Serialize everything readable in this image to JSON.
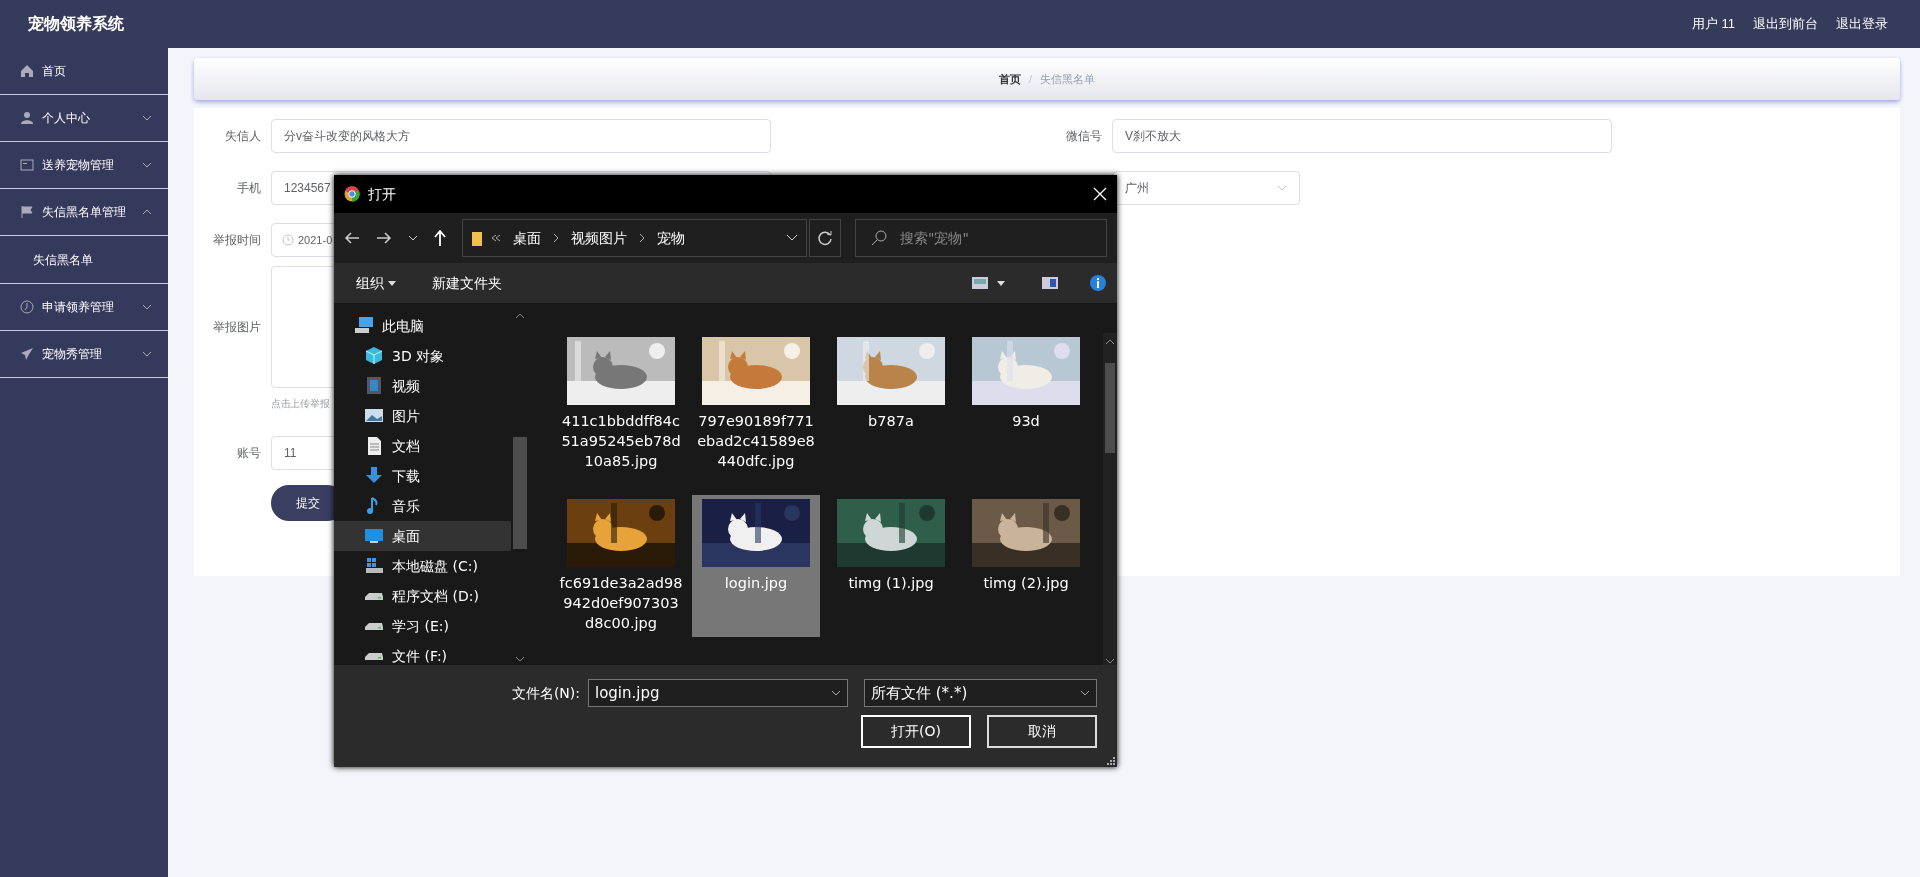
{
  "app": {
    "title": "宠物领养系统"
  },
  "top_nav": [
    {
      "label": "用户 11"
    },
    {
      "label": "退出到前台"
    },
    {
      "label": "退出登录"
    }
  ],
  "sidebar": {
    "items": [
      {
        "label": "首页",
        "kind": "link"
      },
      {
        "label": "个人中心",
        "kind": "group",
        "expanded": false
      },
      {
        "label": "送养宠物管理",
        "kind": "group",
        "expanded": false
      },
      {
        "label": "失信黑名单管理",
        "kind": "group",
        "expanded": true,
        "children": [
          {
            "label": "失信黑名单"
          }
        ]
      },
      {
        "label": "申请领养管理",
        "kind": "group",
        "expanded": false
      },
      {
        "label": "宠物秀管理",
        "kind": "group",
        "expanded": false
      }
    ]
  },
  "breadcrumb": {
    "separator": "/",
    "items": [
      {
        "label": "首页",
        "current": false
      },
      {
        "label": "失信黑名单",
        "current": true
      }
    ]
  },
  "form": {
    "rows": [
      [
        {
          "label": "失信人",
          "kind": "text",
          "value": "分v奋斗改变的风格大方"
        },
        {
          "label": "微信号",
          "kind": "text",
          "value": "V刹不放大"
        }
      ],
      [
        {
          "label": "手机",
          "kind": "text",
          "value": "1234567"
        },
        {
          "kind": "select",
          "value": "广州"
        }
      ],
      [
        {
          "label": "举报时间",
          "kind": "date",
          "value": "2021-0"
        }
      ],
      [
        {
          "label": "举报图片",
          "kind": "upload",
          "hint": "点击上传举报"
        }
      ],
      [
        {
          "label": "账号",
          "kind": "text",
          "value": "11"
        }
      ]
    ],
    "submit": "提交"
  },
  "dialog": {
    "title": "打开",
    "path": [
      "桌面",
      "视频图片",
      "宠物"
    ],
    "search": {
      "placeholder": "搜索\"宠物\""
    },
    "toolbar": {
      "organize": "组织",
      "new_folder": "新建文件夹"
    },
    "tree": [
      {
        "label": "此电脑",
        "selected": false,
        "children": [
          {
            "label": "3D 对象",
            "selected": false
          },
          {
            "label": "视频",
            "selected": false
          },
          {
            "label": "图片",
            "selected": false
          },
          {
            "label": "文档",
            "selected": false
          },
          {
            "label": "下载",
            "selected": false
          },
          {
            "label": "音乐",
            "selected": false
          },
          {
            "label": "桌面",
            "selected": true
          },
          {
            "label": "本地磁盘 (C:)",
            "selected": false
          },
          {
            "label": "程序文档 (D:)",
            "selected": false
          },
          {
            "label": "学习 (E:)",
            "selected": false
          },
          {
            "label": "文件 (F:)",
            "selected": false
          }
        ]
      }
    ],
    "files": [
      {
        "name": "411c1bbddff84c51a95245eb78d10a85.jpg",
        "selected": false
      },
      {
        "name": "797e90189f771ebad2c41589e8440dfc.jpg",
        "selected": false
      },
      {
        "name": "b787a",
        "selected": false
      },
      {
        "name": "93d",
        "selected": false
      },
      {
        "name": "fc691de3a2ad98942d0ef907303d8c00.jpg",
        "selected": false
      },
      {
        "name": "login.jpg",
        "selected": true
      },
      {
        "name": "timg (1).jpg",
        "selected": false
      },
      {
        "name": "timg (2).jpg",
        "selected": false
      }
    ],
    "filename_label": "文件名(N):",
    "filename": "login.jpg",
    "filter": "所有文件 (*.*)",
    "buttons": [
      {
        "label": "打开(O)",
        "kind": "primary"
      },
      {
        "label": "取消",
        "kind": "secondary"
      }
    ]
  }
}
